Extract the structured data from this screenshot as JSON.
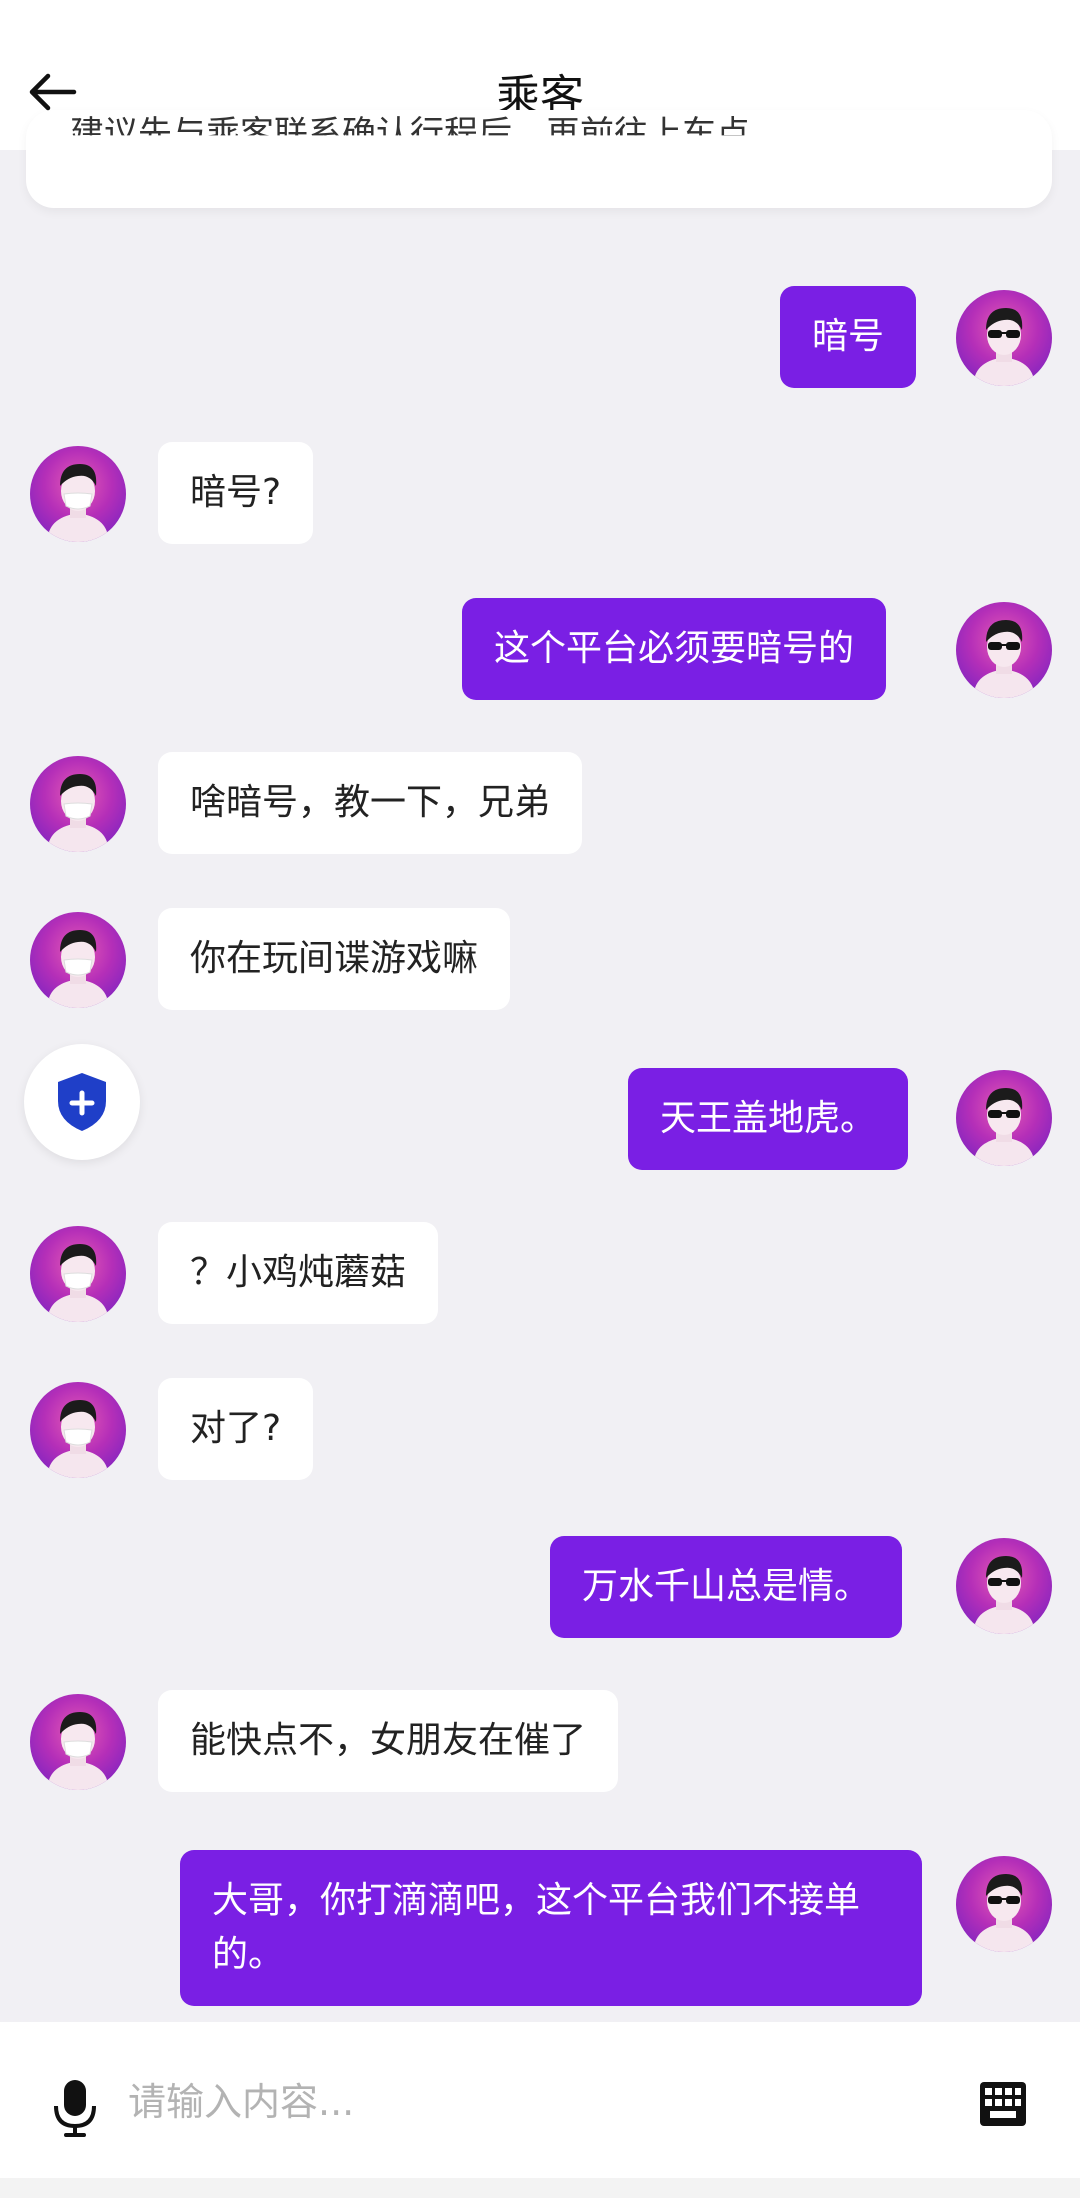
{
  "header": {
    "title": "乘客",
    "back_icon": "arrow-left-icon"
  },
  "notice": {
    "text": "建议先与乘客联系确认行程后，再前往上车点"
  },
  "colors": {
    "accent": "#7a1fe4",
    "background": "#f1f0f4",
    "shield": "#1f3fc8"
  },
  "messages": [
    {
      "side": "right",
      "text": "暗号"
    },
    {
      "side": "left",
      "text": "暗号?"
    },
    {
      "side": "right",
      "text": "这个平台必须要暗号的"
    },
    {
      "side": "left",
      "text": "啥暗号，教一下，兄弟"
    },
    {
      "side": "left",
      "text": "你在玩间谍游戏嘛"
    },
    {
      "side": "right",
      "text": "天王盖地虎。"
    },
    {
      "side": "left",
      "text": "？小鸡炖蘑菇"
    },
    {
      "side": "left",
      "text": "对了?"
    },
    {
      "side": "right",
      "text": "万水千山总是情。"
    },
    {
      "side": "left",
      "text": "能快点不，女朋友在催了"
    },
    {
      "side": "right",
      "text": "大哥，你打滴滴吧，这个平台我们不接单的。"
    }
  ],
  "input": {
    "placeholder": "请输入内容...",
    "value": ""
  },
  "icons": {
    "mic": "microphone-icon",
    "keyboard": "keyboard-icon",
    "shield": "shield-plus-icon"
  }
}
